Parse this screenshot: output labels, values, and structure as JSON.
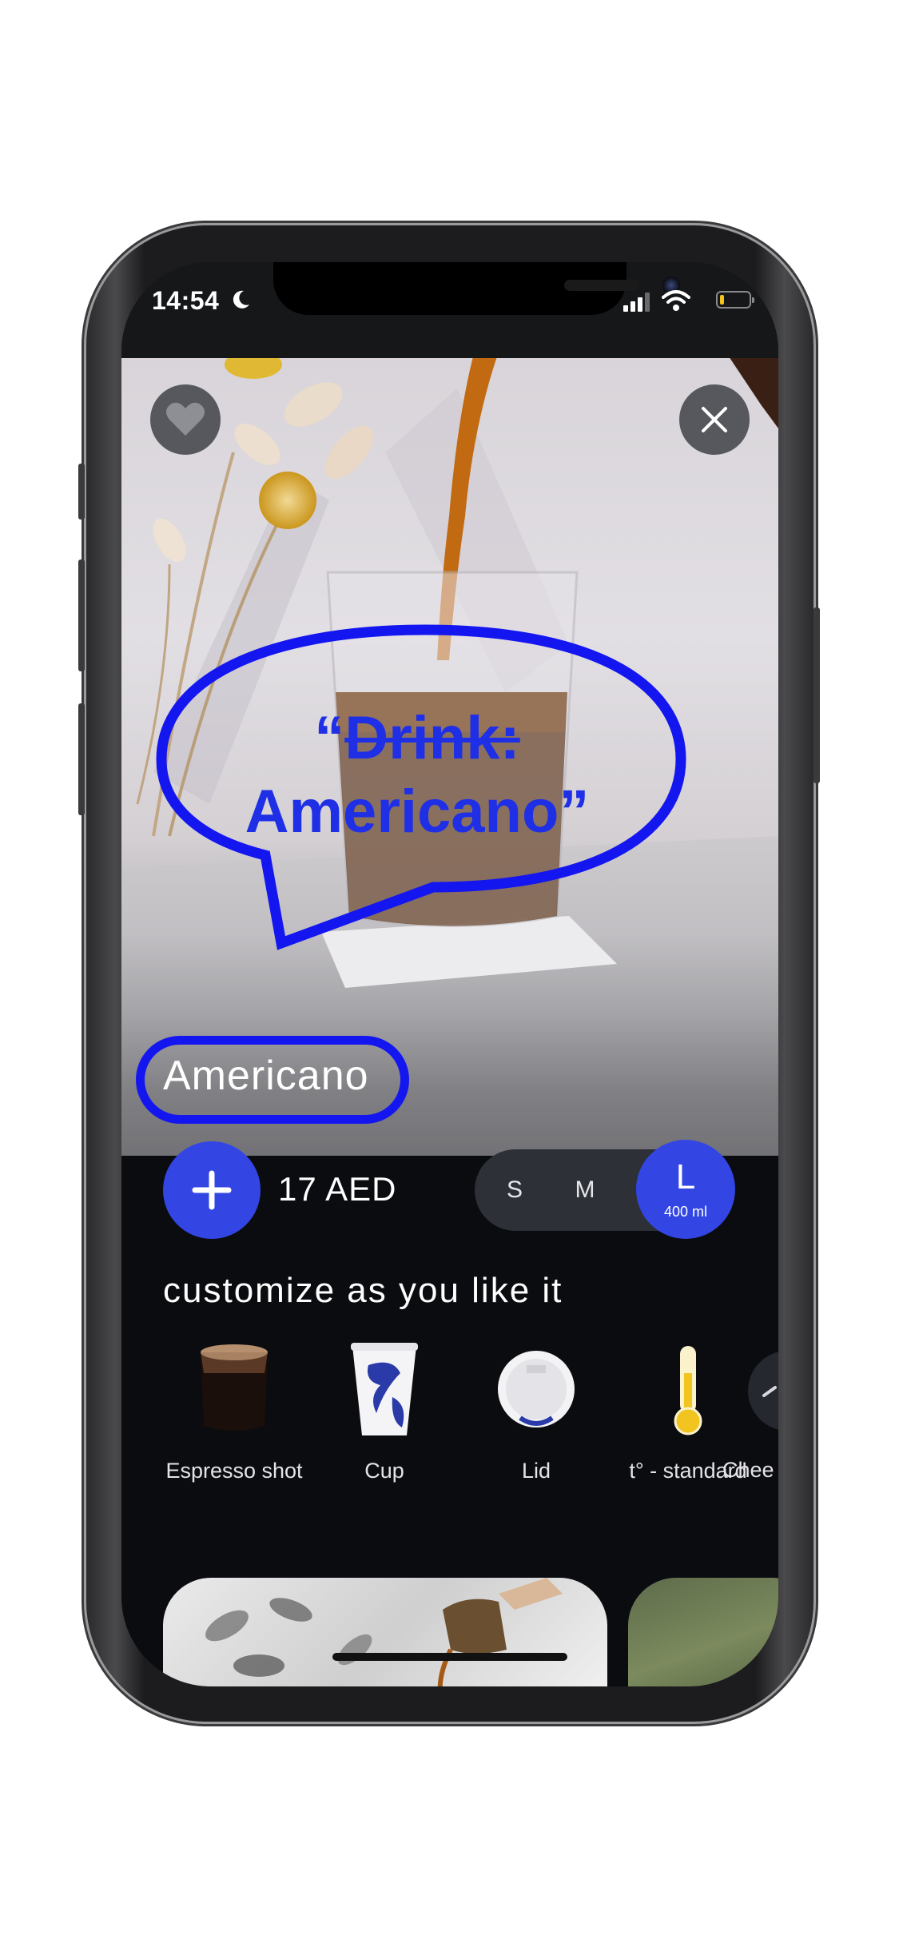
{
  "status_bar": {
    "time": "14:54"
  },
  "annotation": {
    "quote_open": "“",
    "struck_text": "Drink:",
    "replacement_text": "Americano”",
    "color": "#1e2fe6"
  },
  "product": {
    "title": "Americano",
    "price": "17 AED",
    "accent_color": "#3346e4"
  },
  "sizes": {
    "options": [
      "S",
      "M",
      "L"
    ],
    "selected": "L",
    "selected_volume": "400 ml"
  },
  "customize": {
    "title": "customize as you like it",
    "items": [
      {
        "label": "Espresso shot",
        "icon": "espresso-glass-icon"
      },
      {
        "label": "Cup",
        "icon": "paper-cup-icon"
      },
      {
        "label": "Lid",
        "icon": "cup-lid-icon"
      },
      {
        "label": "t° - standard",
        "icon": "thermometer-icon"
      },
      {
        "label": "Chee",
        "icon": "cheese-icon"
      }
    ]
  },
  "icons": {
    "favorite": "heart-icon",
    "close": "close-icon",
    "add": "plus-icon"
  }
}
